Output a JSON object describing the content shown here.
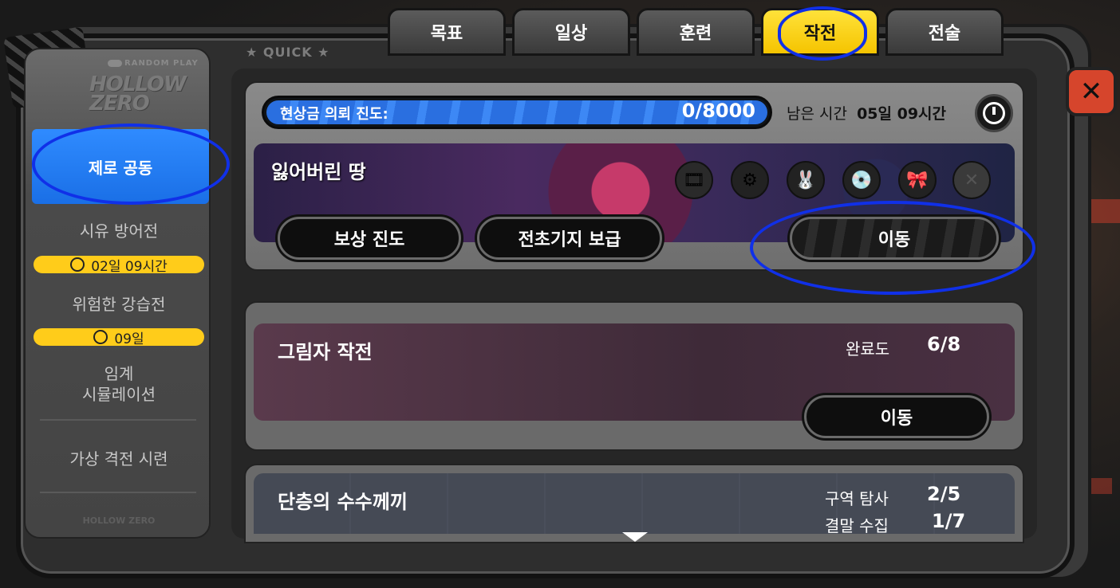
{
  "tabs": [
    {
      "label": "목표"
    },
    {
      "label": "일상"
    },
    {
      "label": "훈련"
    },
    {
      "label": "작전",
      "active": true
    },
    {
      "label": "전술"
    }
  ],
  "close_icon": "close-icon",
  "sidebar": {
    "random_play": "RANDOM PLAY",
    "logo": "HOLLOW ZERO",
    "items": [
      {
        "label": "제로 공동",
        "active": true
      },
      {
        "label": "시유 방어전",
        "badge": "02일 09시간"
      },
      {
        "label": "위험한 강습전",
        "badge": "09일"
      },
      {
        "label": "임계\n시뮬레이션"
      },
      {
        "label": "가상 격전 시련"
      }
    ],
    "footer": "HOLLOW ZERO"
  },
  "quick_label": "QUICK",
  "bounty": {
    "progress_label": "현상금 의뢰 진도:",
    "progress_value": "0/8000",
    "progress_fraction": 0,
    "remain_label": "남은 시간",
    "remain_value": "05일 09시간"
  },
  "lost_land": {
    "title": "잃어버린 땅",
    "rewards": [
      "film-icon",
      "film-reel-icon",
      "bangboo-icon",
      "disc-drive-icon",
      "bunny-icon",
      "locked-icon"
    ],
    "btn_reward": "보상 진도",
    "btn_supply": "전초기지 보급",
    "btn_move": "이동"
  },
  "shadow_op": {
    "title": "그림자 작전",
    "completion_label": "완료도",
    "completion_value": "6/8",
    "btn_move": "이동"
  },
  "puzzle": {
    "title": "단층의 수수께끼",
    "explore_label": "구역 탐사",
    "explore_value": "2/5",
    "ending_label": "결말 수집",
    "ending_value": "1/7"
  },
  "colors": {
    "accent_yellow": "#f5c400",
    "sidebar_active": "#1a6fe6",
    "annotation_blue": "#1030e8",
    "close_red": "#d6452c"
  }
}
